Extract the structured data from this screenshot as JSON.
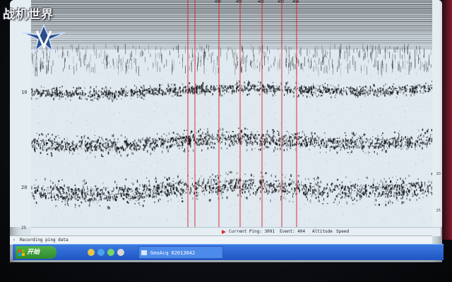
{
  "watermark": {
    "text": "战机世界"
  },
  "depth_axis": {
    "ticks": [
      {
        "label": "10",
        "depth": 10
      },
      {
        "label": "20",
        "depth": 20
      },
      {
        "label": "25",
        "depth": 25
      }
    ]
  },
  "right_axis": {
    "ticks": [
      "20",
      "25"
    ]
  },
  "event_markers": {
    "labels": [
      "",
      "",
      "400",
      "401",
      "402",
      "403",
      "404"
    ],
    "color": "#d42020"
  },
  "echogram": {
    "bottom_layers": [
      "surface",
      "layer-1",
      "layer-2",
      "layer-3"
    ],
    "ink_color": "#1a1d22",
    "paper_color": "#dfe9ef"
  },
  "status_bar": {
    "ping_label": "Current Ping: 3091",
    "event_label": "Event: 404",
    "altitude_label": "Altitude",
    "speed_label": "Speed"
  },
  "app_status": {
    "text": "Recording ping data"
  },
  "taskbar": {
    "start_label": "开始",
    "task_label": "GeoAcq 02013042"
  },
  "colors": {
    "taskbar": "#2a66d6",
    "start": "#3a9a36",
    "event_line": "#d42020"
  }
}
